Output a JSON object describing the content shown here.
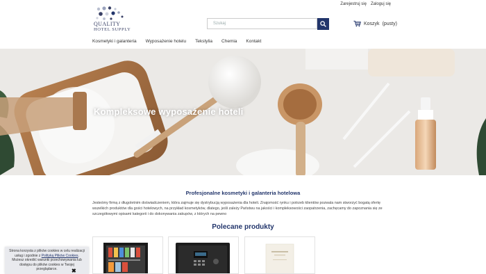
{
  "header": {
    "logo_line1": "QUALITY",
    "logo_line2": "HOTEL SUPPLY",
    "register_link": "Zarejestruj się",
    "login_link": "Zaloguj się",
    "search_placeholder": "Szukaj",
    "cart_label": "Koszyk",
    "cart_status": "(pusty)"
  },
  "nav": {
    "items": [
      "Kosmetyki i galanteria",
      "Wyposażenie hotelu",
      "Tekstylia",
      "Chemia",
      "Kontakt"
    ]
  },
  "hero": {
    "title": "Kompleksowe wyposażenie hoteli"
  },
  "intro": {
    "title": "Profesjonalne kosmetyki i galanteria hotelowa",
    "text": "Jesteśmy firmą z długoletnim doświadczeniem, która zajmuje się dystrybucją wyposażenia dla hoteli. Znajomość rynku i potrzeb klientów pozwala nam stworzyć bogatą ofertę wszelkich produktów dla gości hotelowych, na przykład kosmetyków, dlatego, jeśli zależy Państwu na jakości i kompleksowości zaopatrzenia, zachęcamy do zapoznania się ze szczegółowymi opisami kategorii i do dokonywania zakupów, z których na pewno"
  },
  "featured": {
    "title": "Polecane produkty"
  },
  "cookie": {
    "line1": "Strona korzysta z plików cookies w celu realizacji usług i zgodnie z",
    "link": "Polityką Plików Cookies",
    "line2": ". Możesz określić warunki przechowywania lub dostępu do plików cookies w Twojej przeglądarce.",
    "close": "✖"
  },
  "colors": {
    "brand": "#22356b",
    "cookie_bg": "#e9eaee"
  }
}
